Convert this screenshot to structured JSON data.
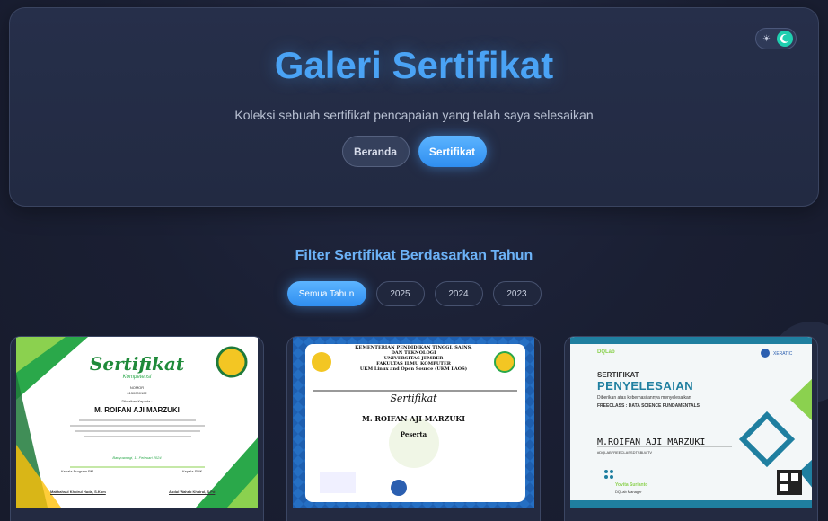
{
  "header": {
    "title": "Galeri Sertifikat",
    "subtitle": "Koleksi sebuah sertifikat pencapaian yang telah saya selesaikan",
    "nav": [
      {
        "label": "Beranda",
        "active": false
      },
      {
        "label": "Sertifikat",
        "active": true
      }
    ],
    "theme_toggle": {
      "sun_icon": "sun-icon",
      "moon_icon": "moon-icon",
      "state": "dark"
    }
  },
  "filter": {
    "title": "Filter Sertifikat Berdasarkan Tahun",
    "options": [
      {
        "label": "Semua Tahun",
        "active": true
      },
      {
        "label": "2025",
        "active": false
      },
      {
        "label": "2024",
        "active": false
      },
      {
        "label": "2023",
        "active": false
      }
    ]
  },
  "certificates": [
    {
      "heading": "Sertifikat",
      "subheading": "Kompetensi",
      "number_label": "NOMOR",
      "number": "0150000102",
      "given_to": "Diberikan Kepada :",
      "name": "M. ROIFAN AJI MARZUKI",
      "date": "Banyuwangi, 11 Februari 2024",
      "sign_left": "Kepala Program PM",
      "sign_left_name": "Makhahsul Khoirul Huda, S.Kom",
      "sign_right": "Kepala SMK",
      "sign_right_name": "Abdul Wahab Khairul, S.Pd"
    },
    {
      "institution_lines": [
        "KEMENTERIAN PENDIDIKAN TINGGI, SAINS,",
        "DAN TEKNOLOGI",
        "UNIVERSITAS JEMBER",
        "FAKULTAS ILMU KOMPUTER",
        "UKM Linux and Open Source (UKM LAOS)"
      ],
      "heading": "Sertifikat",
      "name": "M. ROIFAN AJI MARZUKI",
      "role": "Peserta"
    },
    {
      "brand_left": "DQLab",
      "brand_right": "XERATIC",
      "heading_small": "SERTIFIKAT",
      "heading": "PENYELESAIAN",
      "given_text": "Diberikan atas keberhasilannya menyelesaikan",
      "course": "FREECLASS : DATA SCIENCE FUNDAMENTALS",
      "name": "M.ROIFAN AJI MARZUKI",
      "code": "#DQLABFREECLASSDTSBLWTV",
      "signer": "Yovita Surianto",
      "signer_role": "DQLab Manager"
    }
  ],
  "colors": {
    "accent": "#4aa3f5",
    "background": "#1a1f33",
    "card": "#232a41"
  }
}
